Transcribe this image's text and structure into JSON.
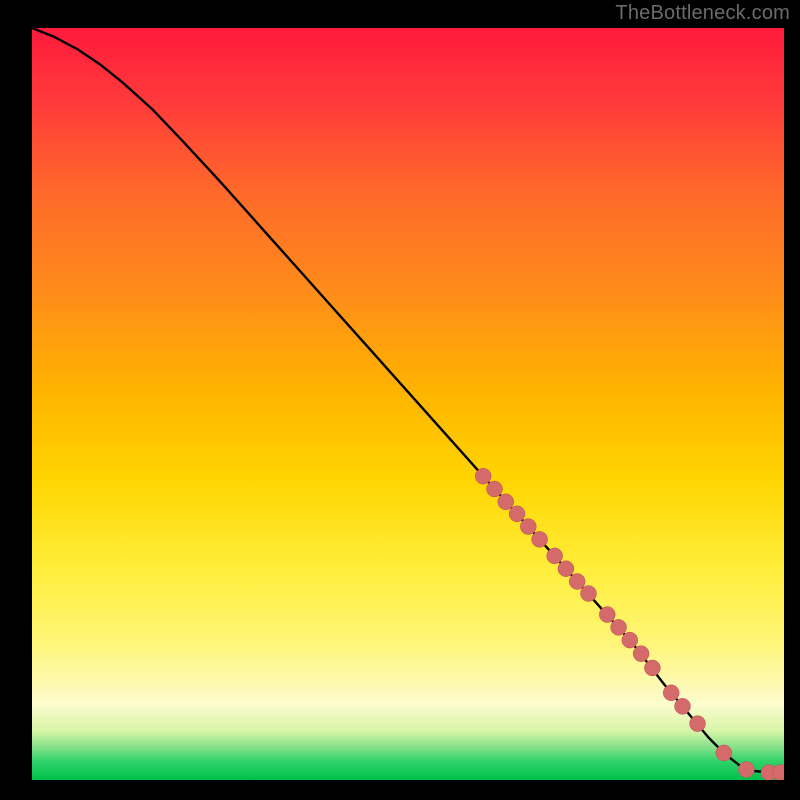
{
  "attribution": "TheBottleneck.com",
  "colors": {
    "background": "#000000",
    "attribution_text": "#6b6b6b",
    "curve": "#000000",
    "marker_fill": "#d46a6a",
    "marker_stroke": "#c05050",
    "gradient_top": "#ff1744",
    "gradient_mid1": "#ff9800",
    "gradient_mid2": "#ffeb3b",
    "gradient_mid3": "#fdfdc8",
    "gradient_bottom_band": "#00e676",
    "gradient_bottom": "#00c853"
  },
  "chart_data": {
    "type": "line",
    "title": "",
    "xlabel": "",
    "ylabel": "",
    "xlim": [
      0,
      100
    ],
    "ylim": [
      0,
      100
    ],
    "curve": {
      "x": [
        0,
        3,
        6,
        9,
        12,
        16,
        20,
        25,
        30,
        35,
        40,
        45,
        50,
        55,
        60,
        65,
        70,
        75,
        80,
        84,
        86,
        88,
        90,
        92,
        94,
        96,
        98,
        100
      ],
      "y": [
        100,
        98.8,
        97.2,
        95.2,
        92.8,
        89.2,
        85.0,
        79.6,
        74.0,
        68.4,
        62.8,
        57.2,
        51.6,
        46.0,
        40.4,
        34.8,
        29.2,
        23.6,
        18.0,
        12.8,
        10.4,
        8.0,
        5.6,
        3.6,
        2.0,
        1.2,
        1.0,
        1.0
      ]
    },
    "markers": {
      "x": [
        60,
        61.5,
        63,
        64.5,
        66,
        67.5,
        69.5,
        71,
        72.5,
        74,
        76.5,
        78,
        79.5,
        81,
        82.5,
        85,
        86.5,
        88.5,
        92,
        95,
        98,
        99.5
      ],
      "y": [
        40.4,
        38.7,
        37.0,
        35.4,
        33.7,
        32.0,
        29.8,
        28.1,
        26.4,
        24.8,
        22.0,
        20.3,
        18.6,
        16.8,
        14.9,
        11.6,
        9.8,
        7.5,
        3.6,
        1.4,
        1.0,
        1.0
      ]
    }
  }
}
